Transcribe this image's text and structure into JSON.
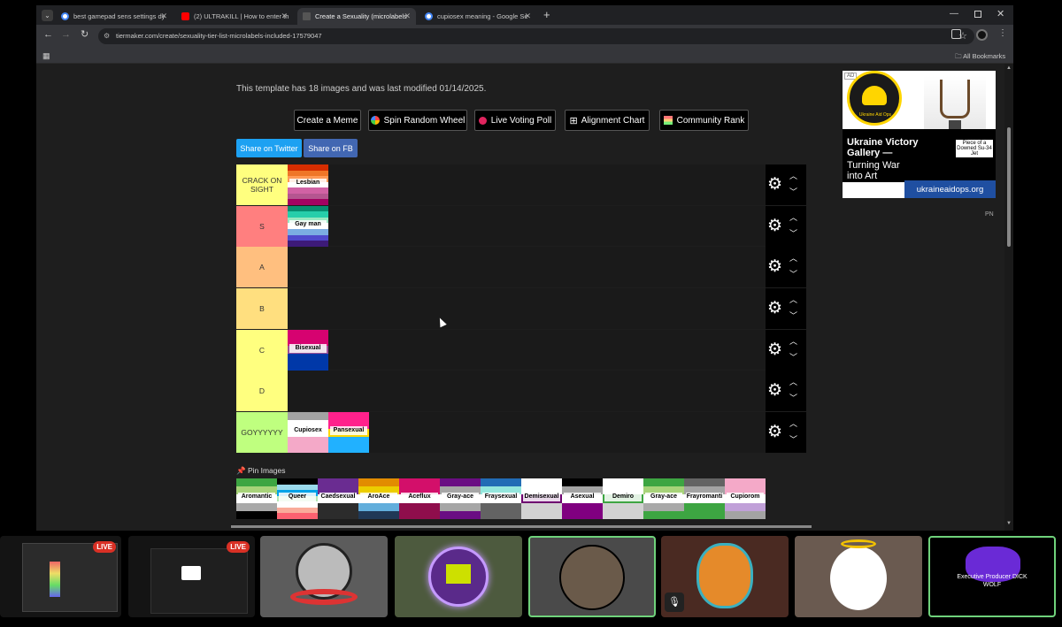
{
  "browser": {
    "tabs": [
      {
        "title": "best gamepad sens settings dy",
        "color": "#4285f4"
      },
      {
        "title": "(2) ULTRAKILL | How to enter th",
        "color": "#ff0000"
      },
      {
        "title": "Create a Sexuality (microlabels",
        "color": "#9a9a9a"
      },
      {
        "title": "cupiosex meaning - Google Se",
        "color": "#4285f4"
      }
    ],
    "url": "tiermaker.com/create/sexuality-tier-list-microlabels-included-17579047",
    "bookmarks_label": "All Bookmarks"
  },
  "page": {
    "template_info": "This template has 18 images and was last modified 01/14/2025.",
    "toolbar": {
      "create_meme": "Create a Meme",
      "spin_wheel": "Spin Random Wheel",
      "live_poll": "Live Voting Poll",
      "alignment_chart": "Alignment Chart",
      "community_rank": "Community Rank"
    },
    "share": {
      "twitter": "Share on Twitter",
      "facebook": "Share on FB"
    },
    "tiers": [
      {
        "label": "CRACK ON SIGHT",
        "color": "#ffff7f",
        "items": [
          {
            "label": "Lesbian",
            "stripes": [
              "#d52d00",
              "#ef7627",
              "#ff9a56",
              "#ffffff",
              "#d162a4",
              "#b55690",
              "#a30262"
            ]
          }
        ]
      },
      {
        "label": "S",
        "color": "#ff7f7f",
        "items": [
          {
            "label": "Gay man",
            "stripes": [
              "#078d70",
              "#26ceaa",
              "#98e8c1",
              "#ffffff",
              "#7bade2",
              "#5049cc",
              "#3d1a78"
            ]
          }
        ]
      },
      {
        "label": "A",
        "color": "#ffbf7f",
        "items": []
      },
      {
        "label": "B",
        "color": "#ffdf7f",
        "items": []
      },
      {
        "label": "C",
        "color": "#ffff7f",
        "items": [
          {
            "label": "Bisexual",
            "stripes": [
              "#d60270",
              "#d60270",
              "#9b4f96",
              "#0038a8",
              "#0038a8"
            ]
          }
        ]
      },
      {
        "label": "D",
        "color": "#ffff7f",
        "items": []
      },
      {
        "label": "GOYYYYYY",
        "color": "#bfff7f",
        "items": [
          {
            "label": "Cupiosex",
            "stripes": [
              "#a3a3a3",
              "#ffffff",
              "#ffffff",
              "#f4a9c8",
              "#f4a9c8"
            ]
          },
          {
            "label": "Pansexual",
            "stripes": [
              "#ff218c",
              "#ff218c",
              "#ffd800",
              "#21b1ff",
              "#21b1ff"
            ]
          }
        ]
      }
    ],
    "pin_images_label": "Pin Images",
    "pool": [
      {
        "label": "Aromantic",
        "stripes": [
          "#3da542",
          "#a7d379",
          "#ffffff",
          "#a9a9a9",
          "#000000"
        ]
      },
      {
        "label": "Queer",
        "stripes": [
          "#000000",
          "#9ad9eb",
          "#00a3e8",
          "#b5e8b5",
          "#ffffff",
          "#f9ab9a",
          "#fc6170"
        ]
      },
      {
        "label": "Caedsexual",
        "stripes": [
          "#6a2c91",
          "#6a2c91",
          "#ffffff",
          "#2c2c2c",
          "#2c2c2c"
        ]
      },
      {
        "label": "AroAce",
        "stripes": [
          "#e28c00",
          "#eccd00",
          "#ffffff",
          "#62aedc",
          "#203856"
        ]
      },
      {
        "label": "Aceflux",
        "stripes": [
          "#d30f6a",
          "#d30f6a",
          "#ffffff",
          "#8f0e4c",
          "#8f0e4c"
        ]
      },
      {
        "label": "Gray-ace",
        "stripes": [
          "#6a0d83",
          "#a6a6a6",
          "#ffffff",
          "#a6a6a6",
          "#6a0d83"
        ]
      },
      {
        "label": "Fraysexual",
        "stripes": [
          "#226cb5",
          "#94e7dd",
          "#ffffff",
          "#636363",
          "#636363"
        ]
      },
      {
        "label": "Demisexual",
        "stripes": [
          "#ffffff",
          "#ffffff",
          "#6e0070",
          "#d2d2d2",
          "#d2d2d2"
        ]
      },
      {
        "label": "Asexual",
        "stripes": [
          "#000000",
          "#a3a3a3",
          "#ffffff",
          "#800080",
          "#800080"
        ]
      },
      {
        "label": "Demiro",
        "stripes": [
          "#ffffff",
          "#ffffff",
          "#3da542",
          "#d2d2d2",
          "#d2d2d2"
        ]
      },
      {
        "label": "Gray-ace",
        "stripes": [
          "#3da542",
          "#a7d379",
          "#ffffff",
          "#a9a9a9",
          "#3da542"
        ]
      },
      {
        "label": "Frayromanti",
        "stripes": [
          "#636363",
          "#a3a3a3",
          "#ffffff",
          "#3da542",
          "#3da542"
        ]
      },
      {
        "label": "Cupiorom",
        "stripes": [
          "#f4a9c8",
          "#f4a9c8",
          "#ffffff",
          "#c0a0d8",
          "#a3a3a3"
        ]
      }
    ],
    "ad": {
      "badge": "AD",
      "logo_text": "Ukraine Aid Ops",
      "headline": "Ukraine Victory Gallery —",
      "subline": "Turning War into Art",
      "caption": "Piece of a Downed Su-34 Jet",
      "domain": "ukraineaidops.org",
      "corner": "PN"
    }
  },
  "video_strip": {
    "live_label": "LIVE",
    "producer_caption": "Executive Producer DICK WOLF"
  }
}
